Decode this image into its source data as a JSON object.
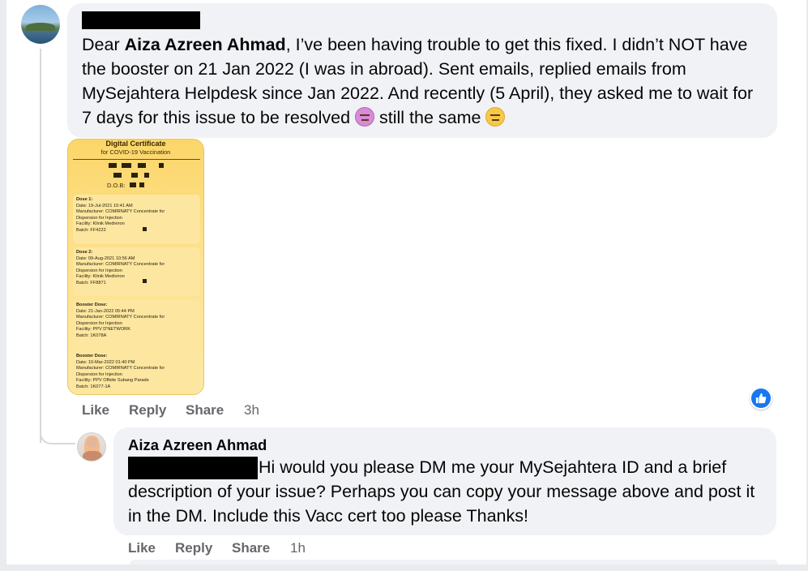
{
  "comment": {
    "body_prefix": "Dear ",
    "mention": "Aiza Azreen Ahmad",
    "body_main": ", I’ve been having trouble to get this fixed. I didn’t NOT have the booster on 21 Jan 2022 (I was in abroad). Sent emails, replied emails from MySejahtera Helpdesk since Jan 2022. And recently (5 April), they asked me to wait for 7 days for this issue to be resolved ",
    "body_after_emoji": " still the same ",
    "emoji_1": "dizzy-face-icon",
    "emoji_2": "expressionless-face-icon",
    "actions": {
      "like": "Like",
      "reply": "Reply",
      "share": "Share",
      "time": "3h"
    }
  },
  "certificate": {
    "title": "Digital Certificate",
    "subtitle": "for COVID-19 Vaccination",
    "dob_label": "D.O.B:",
    "doses": [
      {
        "heading": "Dose 1:",
        "date": "Date: 19-Jul-2021 10:41 AM",
        "manufacturer": "Manufacturer: COMIRNATY Concentrate for",
        "manufacturer_2": "Dispersion for Injection",
        "facility": "Facility: Klinik Mediviron",
        "batch": "Batch: FF4222"
      },
      {
        "heading": "Dose 2:",
        "date": "Date: 09-Aug-2021 10:56 AM",
        "manufacturer": "Manufacturer: COMIRNATY Concentrate for",
        "manufacturer_2": "Dispersion for Injection",
        "facility": "Facility: Klinik Mediviron",
        "batch": "Batch: FF8871"
      },
      {
        "heading": "Booster Dose:",
        "date": "Date: 21-Jan-2022 05:44 PM",
        "manufacturer": "Manufacturer: COMIRNATY Concentrate for",
        "manufacturer_2": "Dispersion for Injection",
        "facility": "Facility: PPV D'NETWORK",
        "batch": "Batch: 1K078A"
      },
      {
        "heading": "Booster Dose:",
        "date": "Date: 10-Mar-2022 01:40 PM",
        "manufacturer": "Manufacturer: COMIRNATY Concentrate for",
        "manufacturer_2": "Dispersion for Injection",
        "facility": "Facility: PPV Offsite Subang Parade",
        "batch": "Batch: 1K077-1A"
      }
    ]
  },
  "reply": {
    "author": "Aiza Azreen Ahmad",
    "body": "Hi would you please DM me your MySejahtera ID and a brief description of your issue? Perhaps you can copy your message above and post it in the DM. Include this Vacc cert too please Thanks!",
    "actions": {
      "like": "Like",
      "reply": "Reply",
      "share": "Share",
      "time": "1h"
    }
  },
  "reaction": {
    "icon": "thumbs-up-icon",
    "color": "#1877f2"
  }
}
